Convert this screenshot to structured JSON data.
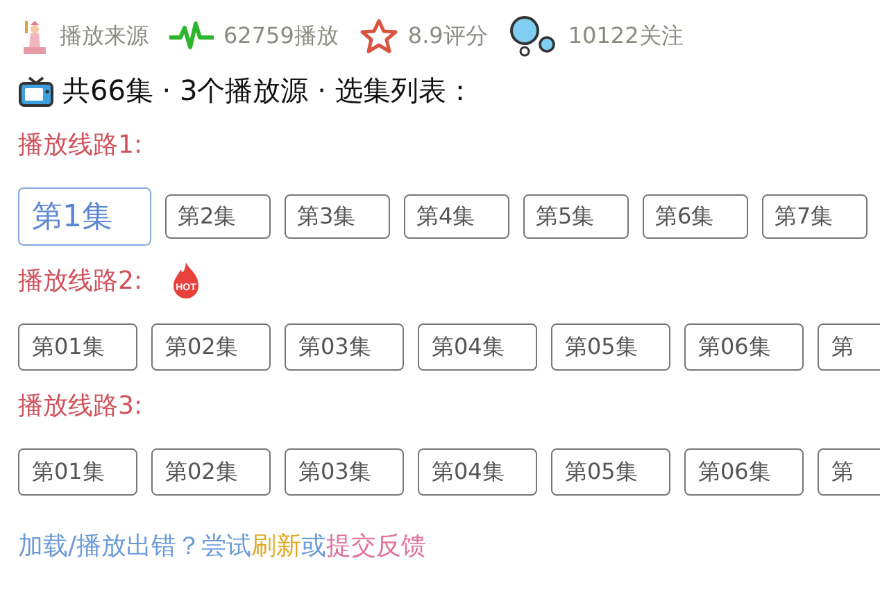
{
  "stats": [
    {
      "kind": "source",
      "text": "播放来源"
    },
    {
      "kind": "plays",
      "text": "62759播放"
    },
    {
      "kind": "rating",
      "text": "8.9评分"
    },
    {
      "kind": "follows",
      "text": "10122关注"
    }
  ],
  "summary": "共66集 · 3个播放源 · 选集列表：",
  "routes": [
    {
      "label": "播放线路1:",
      "episodes": [
        {
          "label": "第1集",
          "selected": true
        },
        {
          "label": "第2集",
          "selected": false
        },
        {
          "label": "第3集",
          "selected": false
        },
        {
          "label": "第4集",
          "selected": false
        },
        {
          "label": "第5集",
          "selected": false
        },
        {
          "label": "第6集",
          "selected": false
        },
        {
          "label": "第7集",
          "selected": false
        }
      ]
    },
    {
      "label": "播放线路2:",
      "badge": "HOT",
      "episodes": [
        {
          "label": "第01集",
          "selected": false
        },
        {
          "label": "第02集",
          "selected": false
        },
        {
          "label": "第03集",
          "selected": false
        },
        {
          "label": "第04集",
          "selected": false
        },
        {
          "label": "第05集",
          "selected": false
        },
        {
          "label": "第06集",
          "selected": false
        },
        {
          "label": "第",
          "selected": false
        }
      ]
    },
    {
      "label": "播放线路3:",
      "episodes": [
        {
          "label": "第01集",
          "selected": false
        },
        {
          "label": "第02集",
          "selected": false
        },
        {
          "label": "第03集",
          "selected": false
        },
        {
          "label": "第04集",
          "selected": false
        },
        {
          "label": "第05集",
          "selected": false
        },
        {
          "label": "第06集",
          "selected": false
        },
        {
          "label": "第",
          "selected": false
        }
      ]
    }
  ],
  "footer": [
    {
      "text": "加载/播放出错？尝试",
      "color": "#6a9ad8"
    },
    {
      "text": "刷新",
      "color": "#e0a820"
    },
    {
      "text": "或",
      "color": "#6a9ad8"
    },
    {
      "text": "提交反馈",
      "color": "#e0709a"
    }
  ]
}
